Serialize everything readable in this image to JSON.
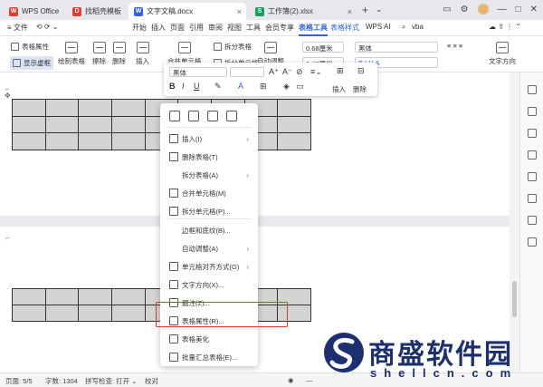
{
  "titlebar": {
    "tabs": [
      {
        "label": "WPS Office",
        "color": "#e33b2e",
        "glyph": "W"
      },
      {
        "label": "找稻壳模板",
        "color": "#e33b2e",
        "glyph": "D"
      },
      {
        "label": "文字文稿.docx",
        "color": "#2e63d9",
        "glyph": "W"
      },
      {
        "label": "工作簿(2).xlsx",
        "color": "#1a9e5c",
        "glyph": "S"
      }
    ],
    "new_tab": "+",
    "more": "⌄"
  },
  "menubar": {
    "file": "≡ 文件",
    "items": [
      "开始",
      "插入",
      "页面",
      "引用",
      "审阅",
      "视图",
      "工具",
      "会员专享",
      "表格工具",
      "表格样式"
    ],
    "wps_ai": "WPS AI",
    "search": "vba"
  },
  "ribbon": {
    "table_props": "表格属性",
    "show_grid": "显示虚框",
    "draw_table": "绘制表格",
    "erase": "擦除",
    "delete": "删除",
    "insert": "插入",
    "merge": "合并单元格",
    "split_table": "拆分表格",
    "split_cell": "拆分单元格",
    "autofit": "自动调整",
    "height": "0.68厘米",
    "width": "1.46厘米",
    "font": "黑体",
    "font_size": "小四",
    "text_dir": "文字方向",
    "align": "对齐方式"
  },
  "minitoolbar": {
    "font": "黑体",
    "insert": "插入",
    "delete": "删除"
  },
  "context_menu": {
    "items": [
      {
        "label": "插入(I)",
        "arrow": true
      },
      {
        "label": "删除表格(T)",
        "arrow": false
      },
      {
        "label": "拆分表格(A)",
        "arrow": true
      },
      {
        "label": "合并单元格(M)",
        "arrow": false
      },
      {
        "label": "拆分单元格(P)...",
        "arrow": false
      },
      {
        "label": "边框和底纹(B)...",
        "arrow": false
      },
      {
        "label": "自动调整(A)",
        "arrow": true
      },
      {
        "label": "单元格对齐方式(G)",
        "arrow": true
      },
      {
        "label": "文字方向(X)...",
        "arrow": false
      },
      {
        "label": "题注(Z)...",
        "arrow": false
      },
      {
        "label": "表格属性(R)...",
        "arrow": false
      },
      {
        "label": "表格美化",
        "arrow": false
      },
      {
        "label": "批量汇总表格(E)...",
        "arrow": false
      }
    ],
    "arrow_glyph": "›"
  },
  "statusbar": {
    "page": "页面: 5/5",
    "words": "字数: 1304",
    "spell": "拼写检查: 打开 ⌄",
    "proof": "校对",
    "zoom_minus": "—"
  },
  "watermark": {
    "cn": "商盛软件园",
    "en": "shellcn.com"
  },
  "colors": {
    "accent": "#2e63d9",
    "highlight": "#e23a2e",
    "cell": "#d4d4d4"
  }
}
